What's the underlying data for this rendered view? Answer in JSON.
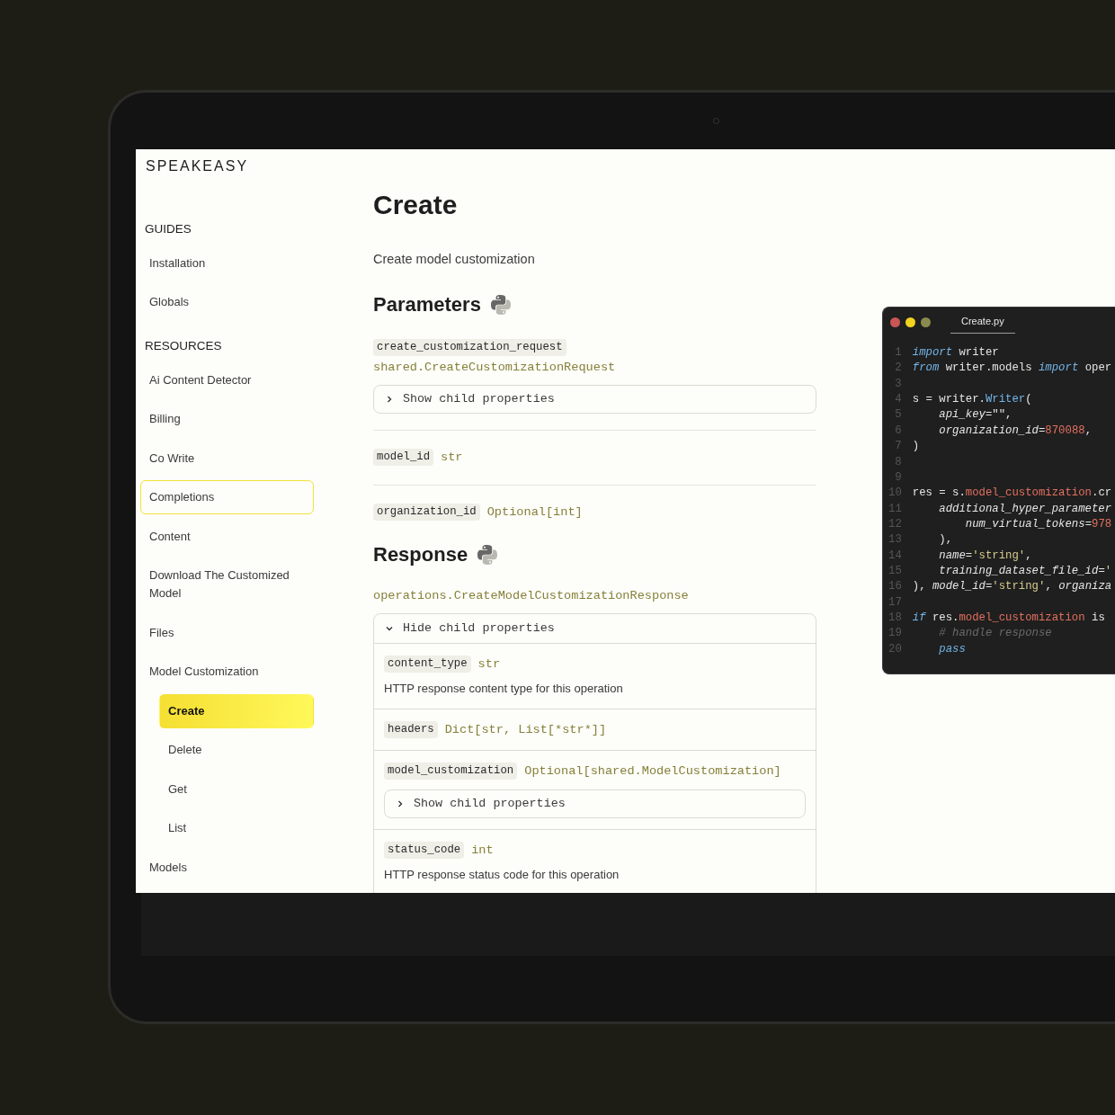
{
  "logo": "SPEAKEASY",
  "sidebar": {
    "sections": [
      {
        "title": "GUIDES",
        "items": [
          {
            "label": "Installation",
            "selected": false,
            "focused": false
          },
          {
            "label": "Globals",
            "selected": false,
            "focused": false
          }
        ]
      },
      {
        "title": "RESOURCES",
        "items": [
          {
            "label": "Ai Content Detector",
            "selected": false,
            "focused": false
          },
          {
            "label": "Billing",
            "selected": false,
            "focused": false
          },
          {
            "label": "Co Write",
            "selected": false,
            "focused": false
          },
          {
            "label": "Completions",
            "selected": false,
            "focused": true
          },
          {
            "label": "Content",
            "selected": false,
            "focused": false
          },
          {
            "label": "Download The Customized Model",
            "selected": false,
            "focused": false
          },
          {
            "label": "Files",
            "selected": false,
            "focused": false
          },
          {
            "label": "Model Customization",
            "selected": false,
            "focused": false,
            "children": [
              {
                "label": "Create",
                "selected": true,
                "focused": false
              },
              {
                "label": "Delete",
                "selected": false,
                "focused": false
              },
              {
                "label": "Get",
                "selected": false,
                "focused": false
              },
              {
                "label": "List",
                "selected": false,
                "focused": false
              }
            ]
          },
          {
            "label": "Models",
            "selected": false,
            "focused": false
          }
        ]
      }
    ]
  },
  "page": {
    "title": "Create",
    "description": "Create model customization"
  },
  "parameters": {
    "heading": "Parameters",
    "items": [
      {
        "name": "create_customization_request",
        "type": "shared.CreateCustomizationRequest",
        "type_below": true,
        "expander": {
          "label": "Show child properties",
          "expanded": false
        }
      },
      {
        "name": "model_id",
        "type": "str",
        "type_below": false
      },
      {
        "name": "organization_id",
        "type": "Optional[int]",
        "type_below": false
      }
    ]
  },
  "response": {
    "heading": "Response",
    "type": "operations.CreateModelCustomizationResponse",
    "expander": {
      "label": "Hide child properties",
      "expanded": true
    },
    "fields": [
      {
        "name": "content_type",
        "type": "str",
        "description": "HTTP response content type for this operation"
      },
      {
        "name": "headers",
        "type": "Dict[str, List[*str*]]"
      },
      {
        "name": "model_customization",
        "type": "Optional[shared.ModelCustomization]",
        "expander": {
          "label": "Show child properties",
          "expanded": false
        }
      },
      {
        "name": "status_code",
        "type": "int",
        "description": "HTTP response status code for this operation"
      }
    ]
  },
  "code_window": {
    "tab": "Create.py",
    "lines": [
      {
        "number": "1",
        "tokens": [
          {
            "kind": "keyword",
            "text": "import"
          },
          {
            "kind": "plain",
            "text": " writer"
          }
        ]
      },
      {
        "number": "2",
        "tokens": [
          {
            "kind": "keyword",
            "text": "from"
          },
          {
            "kind": "plain",
            "text": " writer.models "
          },
          {
            "kind": "keyword",
            "text": "import"
          },
          {
            "kind": "plain",
            "text": " oper"
          }
        ]
      },
      {
        "number": "3"
      },
      {
        "number": "4",
        "tokens": [
          {
            "kind": "plain",
            "text": "s = writer."
          },
          {
            "kind": "func",
            "text": "Writer"
          },
          {
            "kind": "plain",
            "text": "("
          }
        ]
      },
      {
        "number": "5",
        "tokens": [
          {
            "kind": "param",
            "text": "    api_key"
          },
          {
            "kind": "plain",
            "text": "=\"\","
          }
        ]
      },
      {
        "number": "6",
        "tokens": [
          {
            "kind": "param",
            "text": "    organization_id"
          },
          {
            "kind": "plain",
            "text": "="
          },
          {
            "kind": "number",
            "text": "870088"
          },
          {
            "kind": "plain",
            "text": ","
          }
        ]
      },
      {
        "number": "7",
        "tokens": [
          {
            "kind": "plain",
            "text": ")"
          }
        ]
      },
      {
        "number": "8"
      },
      {
        "number": "9"
      },
      {
        "number": "10",
        "tokens": [
          {
            "kind": "plain",
            "text": "res = s."
          },
          {
            "kind": "attr",
            "text": "model_customization"
          },
          {
            "kind": "plain",
            "text": ".cr"
          }
        ]
      },
      {
        "number": "11",
        "tokens": [
          {
            "kind": "param",
            "text": "    additional_hyper_parameter"
          }
        ]
      },
      {
        "number": "12",
        "tokens": [
          {
            "kind": "param",
            "text": "        num_virtual_tokens"
          },
          {
            "kind": "plain",
            "text": "="
          },
          {
            "kind": "number",
            "text": "978"
          }
        ]
      },
      {
        "number": "13",
        "tokens": [
          {
            "kind": "plain",
            "text": "    ),"
          }
        ]
      },
      {
        "number": "14",
        "tokens": [
          {
            "kind": "param",
            "text": "    name"
          },
          {
            "kind": "plain",
            "text": "="
          },
          {
            "kind": "string",
            "text": "'string'"
          },
          {
            "kind": "plain",
            "text": ","
          }
        ]
      },
      {
        "number": "15",
        "tokens": [
          {
            "kind": "param",
            "text": "    training_dataset_file_id"
          },
          {
            "kind": "plain",
            "text": "="
          },
          {
            "kind": "string",
            "text": "'"
          }
        ]
      },
      {
        "number": "16",
        "tokens": [
          {
            "kind": "plain",
            "text": "), "
          },
          {
            "kind": "param",
            "text": "model_id"
          },
          {
            "kind": "plain",
            "text": "="
          },
          {
            "kind": "string",
            "text": "'string'"
          },
          {
            "kind": "plain",
            "text": ", "
          },
          {
            "kind": "param",
            "text": "organiza"
          }
        ]
      },
      {
        "number": "17"
      },
      {
        "number": "18",
        "tokens": [
          {
            "kind": "keyword",
            "text": "if"
          },
          {
            "kind": "plain",
            "text": " res."
          },
          {
            "kind": "attr",
            "text": "model_customization"
          },
          {
            "kind": "plain",
            "text": " is"
          }
        ]
      },
      {
        "number": "19",
        "tokens": [
          {
            "kind": "comment",
            "text": "    # handle response"
          }
        ]
      },
      {
        "number": "20",
        "tokens": [
          {
            "kind": "keyword",
            "text": "    pass"
          }
        ]
      }
    ]
  }
}
